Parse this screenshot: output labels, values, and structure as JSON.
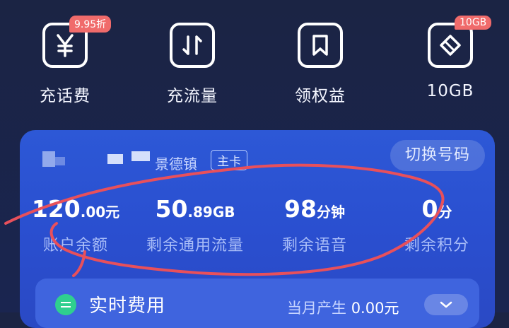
{
  "quick_actions": [
    {
      "label": "充话费",
      "badge": "9.95折",
      "icon": "yuan-icon"
    },
    {
      "label": "充流量",
      "badge": "",
      "icon": "up-down-arrows-icon"
    },
    {
      "label": "领权益",
      "badge": "",
      "icon": "bookmark-icon"
    },
    {
      "label": "10GB",
      "badge": "10GB",
      "icon": "ticket-icon"
    }
  ],
  "card": {
    "city": "景德镇",
    "tag": "主卡",
    "switch_label": "切换号码",
    "stats": [
      {
        "big": "120",
        "small": ".00元",
        "label": "账户余额"
      },
      {
        "big": "50",
        "small": ".89GB",
        "label": "剩余通用流量"
      },
      {
        "big": "98",
        "small": "分钟",
        "label": "剩余语音"
      },
      {
        "big": "0",
        "small": "分",
        "label": "剩余积分"
      }
    ],
    "realtime": {
      "title": "实时费用",
      "month_label": "当月产生",
      "month_value": "0.00元"
    }
  },
  "colors": {
    "background": "#1b2444",
    "card": "#2d58d6",
    "badge": "#f06b6b",
    "accent_green": "#2fcf8f",
    "scribble": "#e8505b"
  }
}
